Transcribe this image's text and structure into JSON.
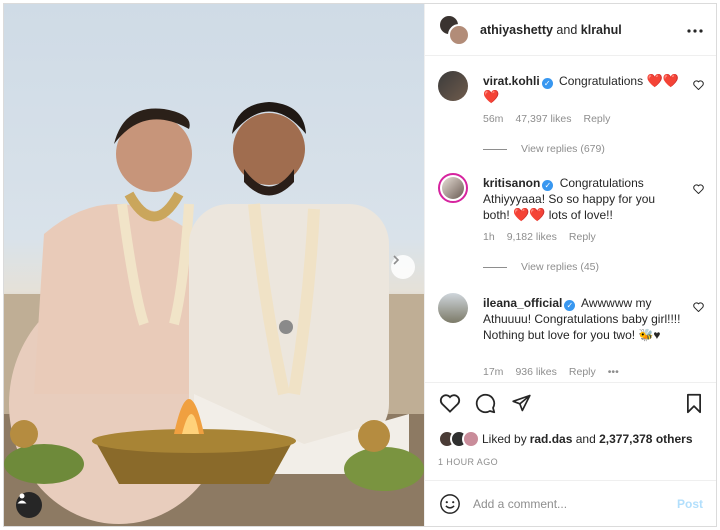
{
  "post": {
    "author_primary": "athiyashetty",
    "author_connector": " and ",
    "author_secondary": "klrahul"
  },
  "colors": {
    "accent": "#3897f0",
    "heart": "#ed4956",
    "muted": "#8e8e8e",
    "text": "#262626"
  },
  "comments": [
    {
      "username": "virat.kohli",
      "text": "Congratulations",
      "trailing": "❤️❤️❤️",
      "time": "56m",
      "likes": "47,397 likes",
      "reply": "Reply",
      "view_replies": "View replies (679)"
    },
    {
      "username": "kritisanon",
      "text": "Congratulations Athiyyyaaa! So so happy for you both!",
      "trailing": "❤️❤️",
      "text_end": "lots of love!!",
      "time": "1h",
      "likes": "9,182 likes",
      "reply": "Reply",
      "view_replies": "View replies (45)"
    },
    {
      "username": "ileana_official",
      "text": "Awwwww my Athuuuu! Congratulations baby girl!!!! Nothing but love for you two!",
      "trailing": "🐝♥",
      "time": "17m",
      "likes": "936 likes",
      "reply": "Reply",
      "more": "•••"
    }
  ],
  "likes": {
    "prefix": "Liked by ",
    "user": "rad.das",
    "middle": " and ",
    "count": "2,377,378 others"
  },
  "time_ago": "1 HOUR AGO",
  "composer": {
    "placeholder": "Add a comment...",
    "post_label": "Post"
  },
  "icons": [
    "more-icon",
    "heart-icon",
    "comment-icon",
    "share-icon",
    "bookmark-icon",
    "emoji-icon",
    "chevron-right-icon",
    "tag-user-icon",
    "verified-icon"
  ]
}
